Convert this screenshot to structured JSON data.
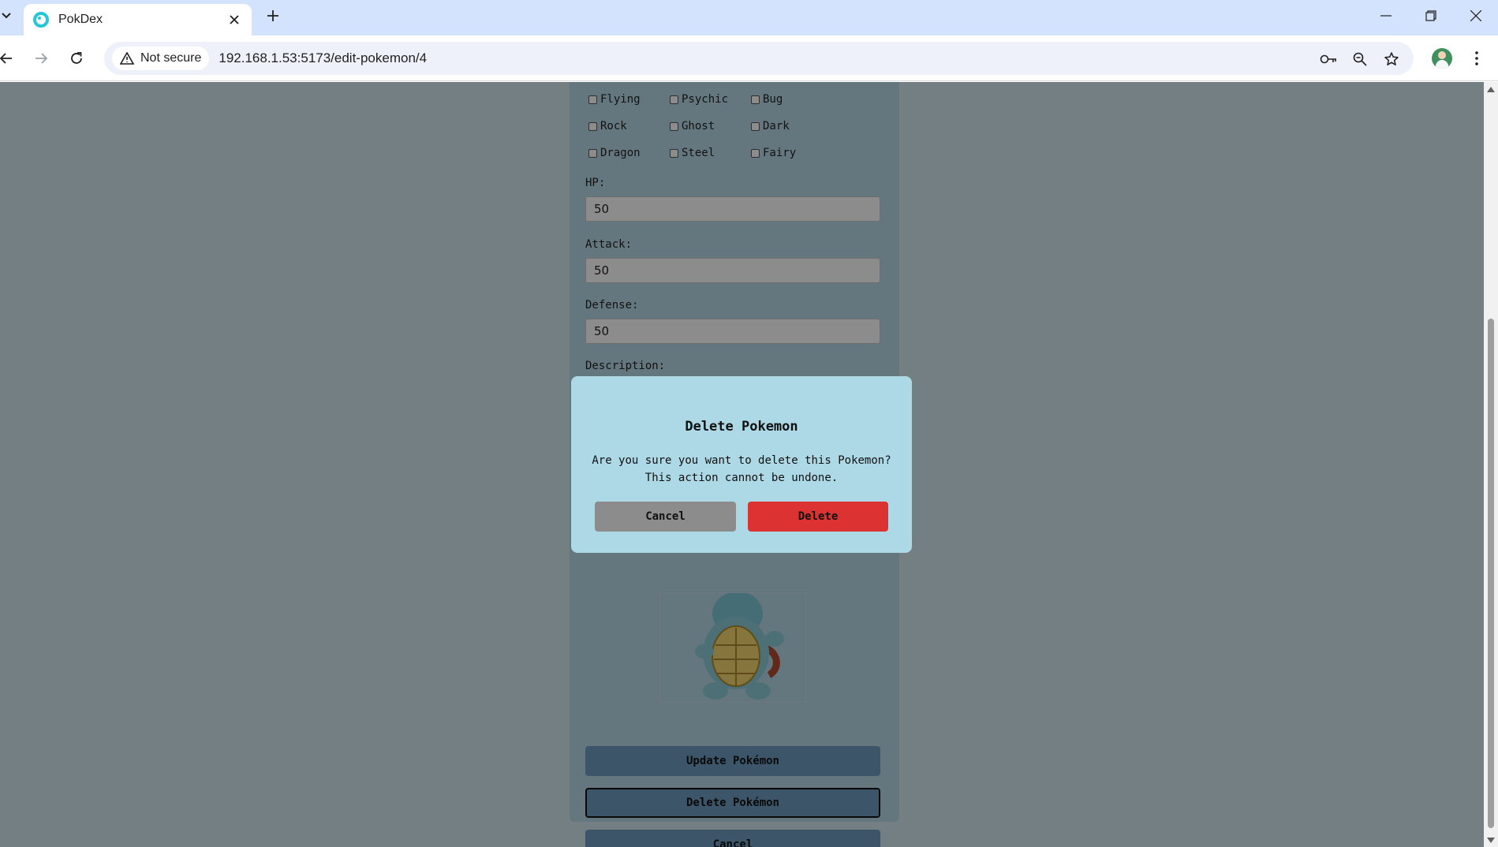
{
  "browser": {
    "tab_title": "PokDex",
    "security_label": "Not secure",
    "url": "192.168.1.53:5173/edit-pokemon/4"
  },
  "form": {
    "types": [
      {
        "label": "Flying",
        "checked": false
      },
      {
        "label": "Psychic",
        "checked": false
      },
      {
        "label": "Bug",
        "checked": false
      },
      {
        "label": "Rock",
        "checked": false
      },
      {
        "label": "Ghost",
        "checked": false
      },
      {
        "label": "Dark",
        "checked": false
      },
      {
        "label": "Dragon",
        "checked": false
      },
      {
        "label": "Steel",
        "checked": false
      },
      {
        "label": "Fairy",
        "checked": false
      }
    ],
    "hp_label": "HP:",
    "hp_value": "50",
    "attack_label": "Attack:",
    "attack_value": "50",
    "defense_label": "Defense:",
    "defense_value": "50",
    "description_label": "Description:",
    "update_button": "Update Pokémon",
    "delete_button": "Delete Pokémon",
    "cancel_button": "Cancel"
  },
  "modal": {
    "title": "Delete Pokemon",
    "message_line1": "Are you sure you want to delete this Pokemon?",
    "message_line2": "This action cannot be undone.",
    "cancel_label": "Cancel",
    "delete_label": "Delete"
  },
  "colors": {
    "modal_bg": "#add8e6",
    "delete_red": "#dc3232",
    "cancel_gray": "#8c8c8c",
    "overlay": "rgba(0,0,0,0.45)"
  }
}
